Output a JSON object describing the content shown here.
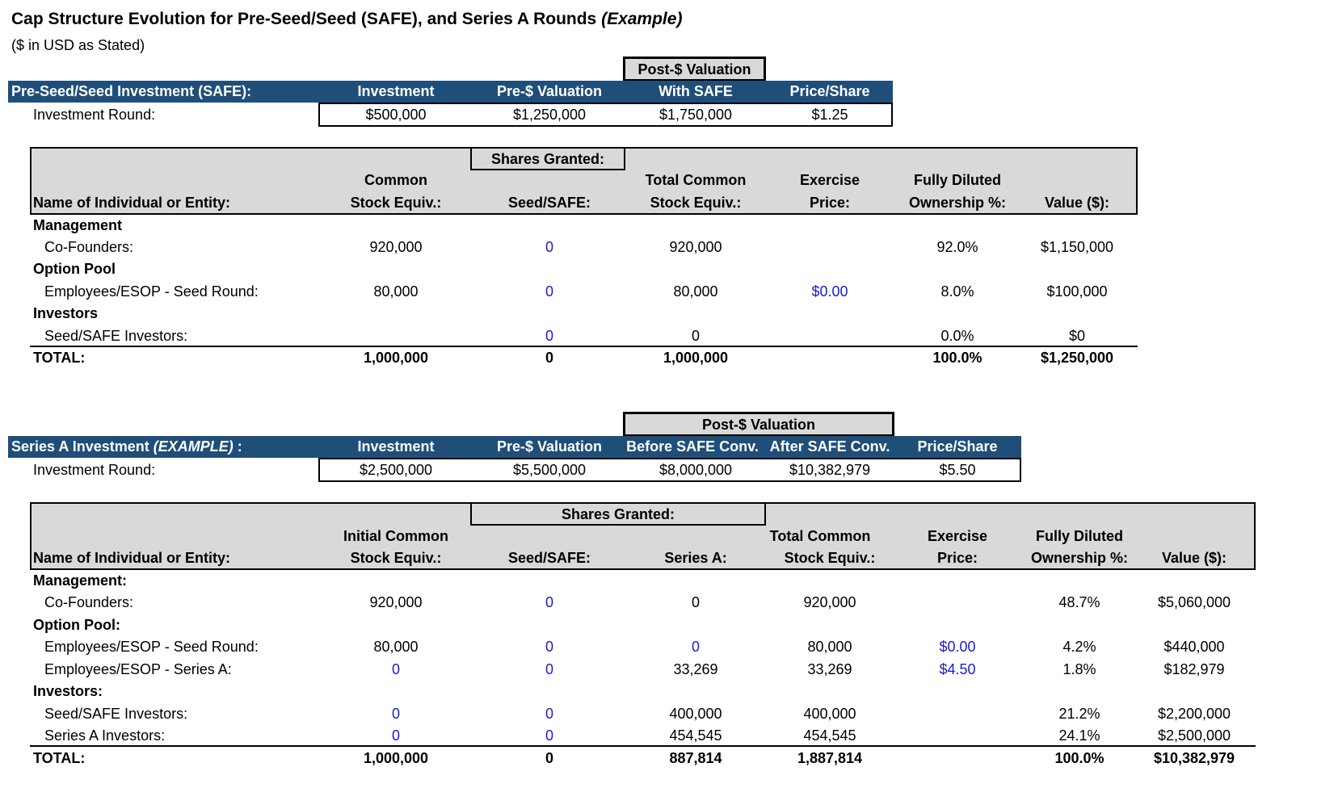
{
  "title": "Cap Structure Evolution for Pre-Seed/Seed (SAFE), and Series A Rounds",
  "title_suffix": "(Example)",
  "subtitle": "($ in USD as Stated)",
  "seed_invest": {
    "post_label": "Post-$ Valuation",
    "header_label": "Pre-Seed/Seed Investment (SAFE):",
    "col_investment": "Investment",
    "col_pre": "Pre-$ Valuation",
    "col_with_safe": "With SAFE",
    "col_price": "Price/Share",
    "round_label": "Investment Round:",
    "investment": "$500,000",
    "pre": "$1,250,000",
    "post": "$1,750,000",
    "price": "$1.25"
  },
  "seed_table": {
    "shares_granted": "Shares Granted:",
    "h_name": "Name of Individual or Entity:",
    "h_common_1": "Common",
    "h_common_2": "Stock Equiv.:",
    "h_seed": "Seed/SAFE:",
    "h_total_1": "Total Common",
    "h_total_2": "Stock Equiv.:",
    "h_ex_1": "Exercise",
    "h_ex_2": "Price:",
    "h_fd_1": "Fully Diluted",
    "h_fd_2": "Ownership %:",
    "h_value": "Value ($):",
    "sec_mgmt": "Management",
    "sec_pool": "Option Pool",
    "sec_inv": "Investors",
    "rows": [
      {
        "name": "Co-Founders:",
        "common": "920,000",
        "seed": "0",
        "total": "920,000",
        "ex": "",
        "fd": "92.0%",
        "value": "$1,150,000"
      },
      {
        "name": "Employees/ESOP - Seed Round:",
        "common": "80,000",
        "seed": "0",
        "total": "80,000",
        "ex": "$0.00",
        "fd": "8.0%",
        "value": "$100,000"
      },
      {
        "name": "Seed/SAFE Investors:",
        "common": "",
        "seed": "0",
        "total": "0",
        "ex": "",
        "fd": "0.0%",
        "value": "$0"
      }
    ],
    "total": {
      "name": "TOTAL:",
      "common": "1,000,000",
      "seed": "0",
      "total": "1,000,000",
      "fd": "100.0%",
      "value": "$1,250,000"
    }
  },
  "seriesa_invest": {
    "post_label": "Post-$ Valuation",
    "header_label_a": "Series A Investment ",
    "header_label_b": "(EXAMPLE)",
    "header_label_c": " :",
    "col_investment": "Investment",
    "col_pre": "Pre-$ Valuation",
    "col_before": "Before SAFE Conv.",
    "col_after": "After SAFE Conv.",
    "col_price": "Price/Share",
    "round_label": "Investment Round:",
    "investment": "$2,500,000",
    "pre": "$5,500,000",
    "before": "$8,000,000",
    "after": "$10,382,979",
    "price": "$5.50"
  },
  "seriesa_table": {
    "shares_granted": "Shares Granted:",
    "h_name": "Name of Individual or Entity:",
    "h_common_1": "Initial Common",
    "h_common_2": "Stock Equiv.:",
    "h_seed": "Seed/SAFE:",
    "h_seriesa": "Series A:",
    "h_total_1": "Total Common",
    "h_total_2": "Stock Equiv.:",
    "h_ex_1": "Exercise",
    "h_ex_2": "Price:",
    "h_fd_1": "Fully Diluted",
    "h_fd_2": "Ownership %:",
    "h_value": "Value ($):",
    "sec_mgmt": "Management:",
    "sec_pool": "Option Pool:",
    "sec_inv": "Investors:",
    "rows": [
      {
        "name": "Co-Founders:",
        "common": "920,000",
        "seed": "0",
        "sa": "0",
        "total": "920,000",
        "ex": "",
        "fd": "48.7%",
        "value": "$5,060,000"
      },
      {
        "name": "Employees/ESOP - Seed Round:",
        "common": "80,000",
        "seed": "0",
        "sa": "0",
        "total": "80,000",
        "ex": "$0.00",
        "fd": "4.2%",
        "value": "$440,000"
      },
      {
        "name": "Employees/ESOP - Series A:",
        "common": "0",
        "seed": "0",
        "sa": "33,269",
        "total": "33,269",
        "ex": "$4.50",
        "fd": "1.8%",
        "value": "$182,979"
      },
      {
        "name": "Seed/SAFE Investors:",
        "common": "0",
        "seed": "0",
        "sa": "400,000",
        "total": "400,000",
        "ex": "",
        "fd": "21.2%",
        "value": "$2,200,000"
      },
      {
        "name": "Series A Investors:",
        "common": "0",
        "seed": "0",
        "sa": "454,545",
        "total": "454,545",
        "ex": "",
        "fd": "24.1%",
        "value": "$2,500,000"
      }
    ],
    "total": {
      "name": "TOTAL:",
      "common": "1,000,000",
      "seed": "0",
      "sa": "887,814",
      "total": "1,887,814",
      "fd": "100.0%",
      "value": "$10,382,979"
    }
  }
}
